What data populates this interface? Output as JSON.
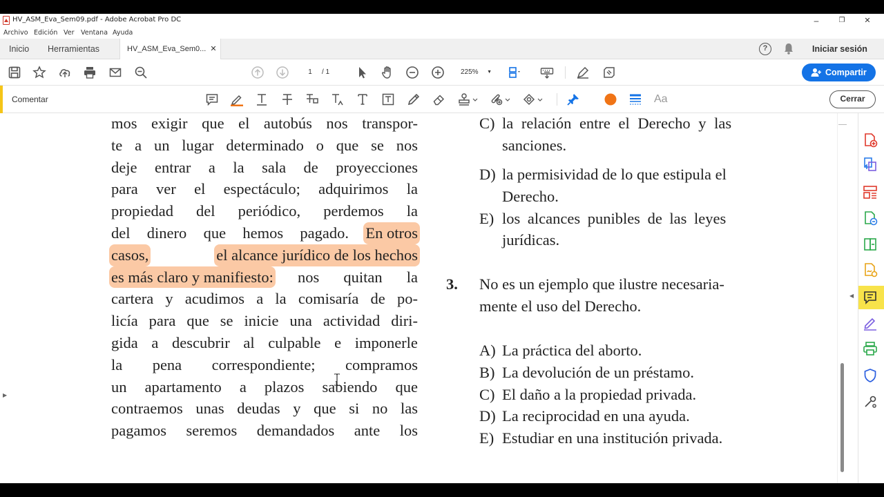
{
  "window": {
    "title": "HV_ASM_Eva_Sem09.pdf - Adobe Acrobat Pro DC",
    "minimize": "–",
    "maximize": "❐",
    "close": "✕"
  },
  "menu": [
    "Archivo",
    "Edición",
    "Ver",
    "Ventana",
    "Ayuda"
  ],
  "tabs": {
    "home": "Inicio",
    "tools": "Herramientas",
    "document": "HV_ASM_Eva_Sem0...",
    "document_close": "✕",
    "signin": "Iniciar sesión"
  },
  "toolbar": {
    "page_current": "1",
    "page_total": "/ 1",
    "zoom": "225%",
    "share_label": "Compartir"
  },
  "comment_bar": {
    "label": "Comentar",
    "close_label": "Cerrar",
    "text_size_label": "Aa",
    "colors": {
      "accent": "#f5c518",
      "marker": "#f07416",
      "highlight": "#fbc9a5"
    }
  },
  "document": {
    "left_column": [
      [
        "mos",
        "exigir",
        "que",
        "el",
        "autobús",
        "nos",
        "transpor-"
      ],
      [
        "te",
        "a",
        "un",
        "lugar",
        "determinado",
        "o",
        "que",
        "se",
        "nos"
      ],
      [
        "deje",
        "entrar",
        "a",
        "la",
        "sala",
        "de",
        "proyecciones"
      ],
      [
        "para",
        "ver",
        "el",
        "espectáculo;",
        "adquirimos",
        "la"
      ],
      [
        "propiedad",
        "del",
        "periódico,",
        "perdemos",
        "la"
      ],
      [
        "del",
        "dinero",
        "que",
        "hemos",
        "pagado.",
        "En otros"
      ],
      [
        "casos,",
        "el alcance jurídico de los hechos"
      ],
      [
        "es más claro y manifiesto:",
        "nos",
        "quitan",
        "la"
      ],
      [
        "cartera",
        "y",
        "acudimos",
        "a",
        "la",
        "comisaría",
        "de",
        "po-"
      ],
      [
        "licía",
        "para",
        "que",
        "se",
        "inicie",
        "una",
        "actividad",
        "diri-"
      ],
      [
        "gida",
        "a",
        "descubrir",
        "al",
        "culpable",
        "e",
        "imponerle"
      ],
      [
        "la",
        "pena",
        "correspondiente;",
        "compramos"
      ],
      [
        "un",
        "apartamento",
        "a",
        "plazos",
        "sabiendo",
        "que"
      ],
      [
        "contraemos",
        "unas",
        "deudas",
        "y",
        "que",
        "si",
        "no",
        "las"
      ],
      [
        "pagamos",
        "seremos",
        "demandados",
        "ante",
        "los"
      ]
    ],
    "prev_options": [
      {
        "letter": "C)",
        "lines": [
          "la  relación  entre  el  Derecho  y  las",
          "sanciones."
        ]
      },
      {
        "letter": "D)",
        "lines": [
          "la permisividad de lo que estipula el",
          "Derecho."
        ]
      },
      {
        "letter": "E)",
        "lines": [
          "los  alcances  punibles  de  las  leyes",
          "jurídicas."
        ]
      }
    ],
    "question3": {
      "number": "3.",
      "lines": [
        "No es un ejemplo que ilustre necesaria-",
        "mente el uso del Derecho."
      ],
      "options": [
        {
          "letter": "A)",
          "text": "La práctica del aborto."
        },
        {
          "letter": "B)",
          "text": "La devolución de un préstamo."
        },
        {
          "letter": "C)",
          "text": "El daño a la propiedad privada."
        },
        {
          "letter": "D)",
          "text": "La reciprocidad en una ayuda."
        },
        {
          "letter": "E)",
          "text": "Estudiar en una institución privada."
        }
      ]
    }
  }
}
